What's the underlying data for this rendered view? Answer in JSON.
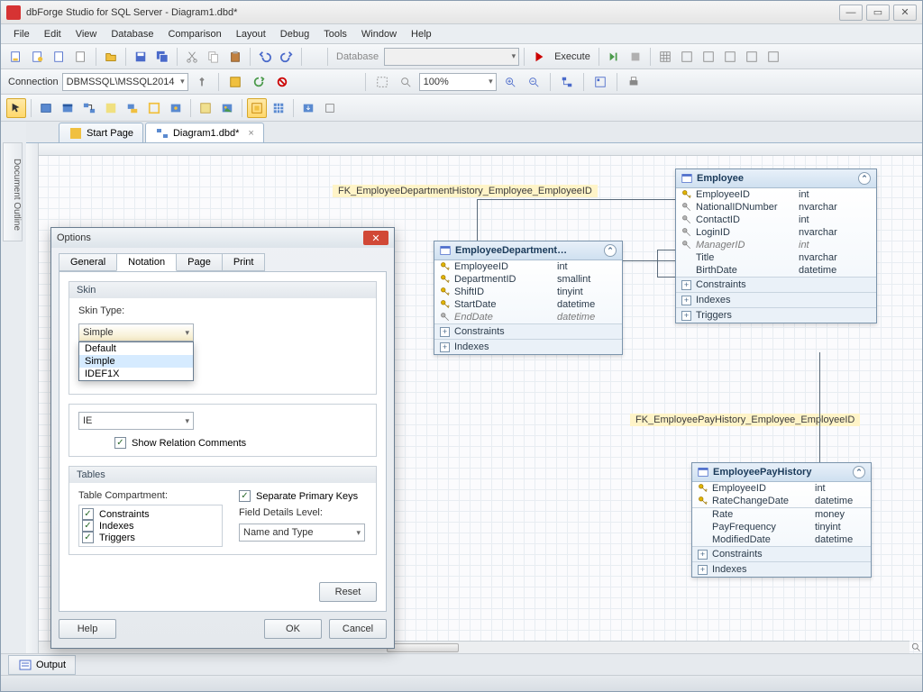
{
  "titlebar": {
    "app": "dbForge Studio for SQL Server",
    "doc": "Diagram1.dbd*"
  },
  "menu": [
    "File",
    "Edit",
    "View",
    "Database",
    "Comparison",
    "Layout",
    "Debug",
    "Tools",
    "Window",
    "Help"
  ],
  "toolbar1": {
    "db_label": "Database",
    "execute": "Execute"
  },
  "connbar": {
    "label": "Connection",
    "value": "DBMSSQL\\MSSQL2014",
    "zoom": "100%"
  },
  "tabs": {
    "start": "Start Page",
    "diagram": "Diagram1.dbd*"
  },
  "side_panel": "Document Outline",
  "entities": {
    "employee": {
      "title": "Employee",
      "fields": [
        {
          "k": "pk",
          "name": "EmployeeID",
          "type": "int"
        },
        {
          "k": "col",
          "name": "NationalIDNumber",
          "type": "nvarchar"
        },
        {
          "k": "col",
          "name": "ContactID",
          "type": "int"
        },
        {
          "k": "col",
          "name": "LoginID",
          "type": "nvarchar"
        },
        {
          "k": "fk",
          "name": "ManagerID",
          "type": "int"
        },
        {
          "k": "none",
          "name": "Title",
          "type": "nvarchar"
        },
        {
          "k": "none",
          "name": "BirthDate",
          "type": "datetime"
        }
      ],
      "sections": [
        "Constraints",
        "Indexes",
        "Triggers"
      ]
    },
    "dept": {
      "title": "EmployeeDepartment…",
      "fields": [
        {
          "k": "pk",
          "name": "EmployeeID",
          "type": "int"
        },
        {
          "k": "pk",
          "name": "DepartmentID",
          "type": "smallint"
        },
        {
          "k": "pk",
          "name": "ShiftID",
          "type": "tinyint"
        },
        {
          "k": "pk",
          "name": "StartDate",
          "type": "datetime"
        },
        {
          "k": "fk",
          "name": "EndDate",
          "type": "datetime"
        }
      ],
      "sections": [
        "Constraints",
        "Indexes"
      ]
    },
    "pay": {
      "title": "EmployeePayHistory",
      "fields": [
        {
          "k": "pk",
          "name": "EmployeeID",
          "type": "int"
        },
        {
          "k": "pk",
          "name": "RateChangeDate",
          "type": "datetime"
        },
        {
          "k": "none",
          "name": "Rate",
          "type": "money"
        },
        {
          "k": "none",
          "name": "PayFrequency",
          "type": "tinyint"
        },
        {
          "k": "none",
          "name": "ModifiedDate",
          "type": "datetime"
        }
      ],
      "sections": [
        "Constraints",
        "Indexes"
      ]
    }
  },
  "fk_labels": {
    "dept": "FK_EmployeeDepartmentHistory_Employee_EmployeeID",
    "pay": "FK_EmployeePayHistory_Employee_EmployeeID"
  },
  "dialog": {
    "title": "Options",
    "tabs": [
      "General",
      "Notation",
      "Page",
      "Print"
    ],
    "active_tab": "Notation",
    "skin": {
      "header": "Skin",
      "label": "Skin Type:",
      "value": "Simple",
      "options": [
        "Default",
        "Simple",
        "IDEF1X"
      ]
    },
    "relation": {
      "show_comments": "Show Relation Comments",
      "combo": "IE"
    },
    "tables": {
      "header": "Tables",
      "compartment_label": "Table Compartment:",
      "compartments": [
        "Constraints",
        "Indexes",
        "Triggers"
      ],
      "separate_pk": "Separate Primary Keys",
      "field_details_label": "Field Details Level:",
      "field_details": "Name and Type"
    },
    "buttons": {
      "reset": "Reset",
      "help": "Help",
      "ok": "OK",
      "cancel": "Cancel"
    }
  },
  "bottom": {
    "output": "Output"
  }
}
